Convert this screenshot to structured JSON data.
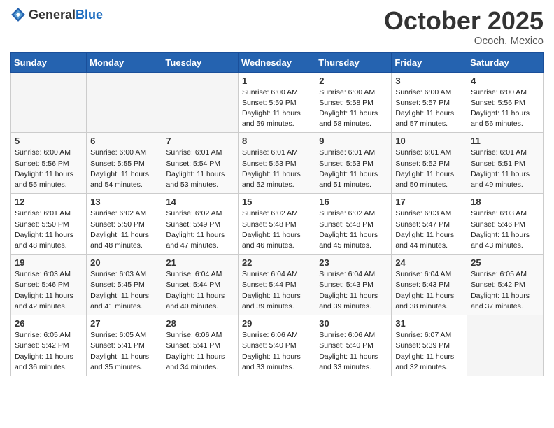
{
  "header": {
    "logo_general": "General",
    "logo_blue": "Blue",
    "month": "October 2025",
    "location": "Ococh, Mexico"
  },
  "weekdays": [
    "Sunday",
    "Monday",
    "Tuesday",
    "Wednesday",
    "Thursday",
    "Friday",
    "Saturday"
  ],
  "weeks": [
    [
      {
        "day": "",
        "info": ""
      },
      {
        "day": "",
        "info": ""
      },
      {
        "day": "",
        "info": ""
      },
      {
        "day": "1",
        "info": "Sunrise: 6:00 AM\nSunset: 5:59 PM\nDaylight: 11 hours\nand 59 minutes."
      },
      {
        "day": "2",
        "info": "Sunrise: 6:00 AM\nSunset: 5:58 PM\nDaylight: 11 hours\nand 58 minutes."
      },
      {
        "day": "3",
        "info": "Sunrise: 6:00 AM\nSunset: 5:57 PM\nDaylight: 11 hours\nand 57 minutes."
      },
      {
        "day": "4",
        "info": "Sunrise: 6:00 AM\nSunset: 5:56 PM\nDaylight: 11 hours\nand 56 minutes."
      }
    ],
    [
      {
        "day": "5",
        "info": "Sunrise: 6:00 AM\nSunset: 5:56 PM\nDaylight: 11 hours\nand 55 minutes."
      },
      {
        "day": "6",
        "info": "Sunrise: 6:00 AM\nSunset: 5:55 PM\nDaylight: 11 hours\nand 54 minutes."
      },
      {
        "day": "7",
        "info": "Sunrise: 6:01 AM\nSunset: 5:54 PM\nDaylight: 11 hours\nand 53 minutes."
      },
      {
        "day": "8",
        "info": "Sunrise: 6:01 AM\nSunset: 5:53 PM\nDaylight: 11 hours\nand 52 minutes."
      },
      {
        "day": "9",
        "info": "Sunrise: 6:01 AM\nSunset: 5:53 PM\nDaylight: 11 hours\nand 51 minutes."
      },
      {
        "day": "10",
        "info": "Sunrise: 6:01 AM\nSunset: 5:52 PM\nDaylight: 11 hours\nand 50 minutes."
      },
      {
        "day": "11",
        "info": "Sunrise: 6:01 AM\nSunset: 5:51 PM\nDaylight: 11 hours\nand 49 minutes."
      }
    ],
    [
      {
        "day": "12",
        "info": "Sunrise: 6:01 AM\nSunset: 5:50 PM\nDaylight: 11 hours\nand 48 minutes."
      },
      {
        "day": "13",
        "info": "Sunrise: 6:02 AM\nSunset: 5:50 PM\nDaylight: 11 hours\nand 48 minutes."
      },
      {
        "day": "14",
        "info": "Sunrise: 6:02 AM\nSunset: 5:49 PM\nDaylight: 11 hours\nand 47 minutes."
      },
      {
        "day": "15",
        "info": "Sunrise: 6:02 AM\nSunset: 5:48 PM\nDaylight: 11 hours\nand 46 minutes."
      },
      {
        "day": "16",
        "info": "Sunrise: 6:02 AM\nSunset: 5:48 PM\nDaylight: 11 hours\nand 45 minutes."
      },
      {
        "day": "17",
        "info": "Sunrise: 6:03 AM\nSunset: 5:47 PM\nDaylight: 11 hours\nand 44 minutes."
      },
      {
        "day": "18",
        "info": "Sunrise: 6:03 AM\nSunset: 5:46 PM\nDaylight: 11 hours\nand 43 minutes."
      }
    ],
    [
      {
        "day": "19",
        "info": "Sunrise: 6:03 AM\nSunset: 5:46 PM\nDaylight: 11 hours\nand 42 minutes."
      },
      {
        "day": "20",
        "info": "Sunrise: 6:03 AM\nSunset: 5:45 PM\nDaylight: 11 hours\nand 41 minutes."
      },
      {
        "day": "21",
        "info": "Sunrise: 6:04 AM\nSunset: 5:44 PM\nDaylight: 11 hours\nand 40 minutes."
      },
      {
        "day": "22",
        "info": "Sunrise: 6:04 AM\nSunset: 5:44 PM\nDaylight: 11 hours\nand 39 minutes."
      },
      {
        "day": "23",
        "info": "Sunrise: 6:04 AM\nSunset: 5:43 PM\nDaylight: 11 hours\nand 39 minutes."
      },
      {
        "day": "24",
        "info": "Sunrise: 6:04 AM\nSunset: 5:43 PM\nDaylight: 11 hours\nand 38 minutes."
      },
      {
        "day": "25",
        "info": "Sunrise: 6:05 AM\nSunset: 5:42 PM\nDaylight: 11 hours\nand 37 minutes."
      }
    ],
    [
      {
        "day": "26",
        "info": "Sunrise: 6:05 AM\nSunset: 5:42 PM\nDaylight: 11 hours\nand 36 minutes."
      },
      {
        "day": "27",
        "info": "Sunrise: 6:05 AM\nSunset: 5:41 PM\nDaylight: 11 hours\nand 35 minutes."
      },
      {
        "day": "28",
        "info": "Sunrise: 6:06 AM\nSunset: 5:41 PM\nDaylight: 11 hours\nand 34 minutes."
      },
      {
        "day": "29",
        "info": "Sunrise: 6:06 AM\nSunset: 5:40 PM\nDaylight: 11 hours\nand 33 minutes."
      },
      {
        "day": "30",
        "info": "Sunrise: 6:06 AM\nSunset: 5:40 PM\nDaylight: 11 hours\nand 33 minutes."
      },
      {
        "day": "31",
        "info": "Sunrise: 6:07 AM\nSunset: 5:39 PM\nDaylight: 11 hours\nand 32 minutes."
      },
      {
        "day": "",
        "info": ""
      }
    ]
  ]
}
